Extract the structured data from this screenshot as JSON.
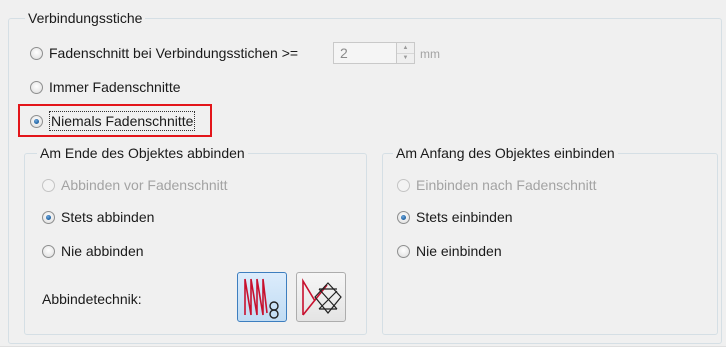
{
  "main_group": {
    "title": "Verbindungsstiche",
    "options": [
      {
        "label": "Fadenschnitt bei Verbindungsstichen >=",
        "selected": false
      },
      {
        "label": "Immer Fadenschnitte",
        "selected": false
      },
      {
        "label": "Niemals Fadenschnitte",
        "selected": true
      }
    ],
    "threshold": {
      "value": "2",
      "unit": "mm",
      "enabled": false
    }
  },
  "end_group": {
    "title": "Am Ende des Objektes abbinden",
    "options": [
      {
        "label": "Abbinden vor Fadenschnitt",
        "selected": false,
        "enabled": false
      },
      {
        "label": "Stets abbinden",
        "selected": true,
        "enabled": true
      },
      {
        "label": "Nie abbinden",
        "selected": false,
        "enabled": true
      }
    ],
    "technique_label": "Abbindetechnik:",
    "technique_buttons": [
      {
        "icon": "tie-off-zigzag-knot-icon",
        "active": true
      },
      {
        "icon": "tie-off-cross-stitch-icon",
        "active": false
      }
    ]
  },
  "start_group": {
    "title": "Am Anfang des Objektes einbinden",
    "options": [
      {
        "label": "Einbinden nach Fadenschnitt",
        "selected": false,
        "enabled": false
      },
      {
        "label": "Stets einbinden",
        "selected": true,
        "enabled": true
      },
      {
        "label": "Nie einbinden",
        "selected": false,
        "enabled": true
      }
    ]
  },
  "colors": {
    "highlight": "#e3151a",
    "radio_checked": "#1c5fa0",
    "active_button_border": "#3d7ebf",
    "icon_stroke": "#c8102e"
  }
}
